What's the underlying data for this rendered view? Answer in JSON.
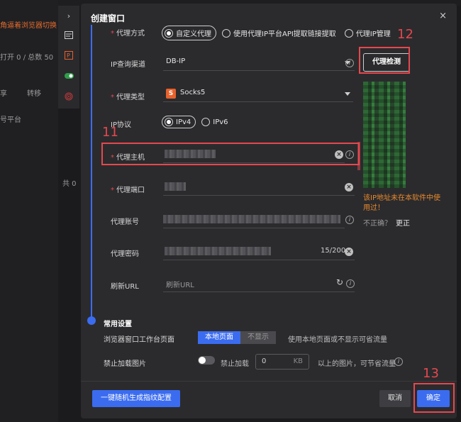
{
  "background": {
    "left_texts": [
      "角逼着浏览器切换",
      "打开 0 / 总数 50",
      "享",
      "转移",
      "号平台",
      "共 0"
    ],
    "sidebar_icons": [
      "chevron-right-icon",
      "window-icon",
      "proxy-icon",
      "toggle-icon",
      "fingerprint-icon"
    ]
  },
  "dialog": {
    "title": "创建窗口",
    "close_symbol": "×",
    "proxy_mode": {
      "label": "代理方式",
      "options": [
        "自定义代理",
        "使用代理IP平台API提取链接提取",
        "代理IP管理"
      ],
      "selected": "自定义代理"
    },
    "ip_query": {
      "label": "IP查询渠道",
      "value": "DB-IP"
    },
    "check_button": "代理检测",
    "proxy_type": {
      "label": "代理类型",
      "value": "Socks5",
      "badge": "S"
    },
    "ip_protocol": {
      "label": "IP协议",
      "options": [
        "IPv4",
        "IPv6"
      ],
      "selected": "IPv4"
    },
    "proxy_host": {
      "label": "代理主机"
    },
    "proxy_port": {
      "label": "代理端口"
    },
    "proxy_account": {
      "label": "代理账号"
    },
    "proxy_password": {
      "label": "代理密码",
      "counter": "15/200"
    },
    "refresh_url": {
      "label": "刷新URL",
      "placeholder": "刷新URL"
    },
    "ip_warning": "该IP地址未在本软件中使用过！",
    "wrong_prompt": "不正确？",
    "change_link": "更正",
    "common": {
      "title": "常用设置",
      "workbench_label": "浏览器窗口工作台页面",
      "seg_on": "本地页面",
      "seg_off": "不显示",
      "workbench_hint": "使用本地页面或不显示可省流量",
      "images_label": "禁止加载图片",
      "toggle_label": "禁止加载",
      "kb_value": "0",
      "kb_unit": "KB",
      "images_hint": "以上的图片，可节省流量"
    },
    "footer": {
      "random_button": "一键随机生成指纹配置",
      "cancel_button": "取消",
      "ok_button": "确定"
    }
  },
  "annotations": {
    "host": "11",
    "check": "12",
    "ok": "13"
  },
  "colors": {
    "accent": "#3b6cf0",
    "annotation": "#e5484d",
    "warning": "#e8892c",
    "socks": "#e8612c"
  }
}
